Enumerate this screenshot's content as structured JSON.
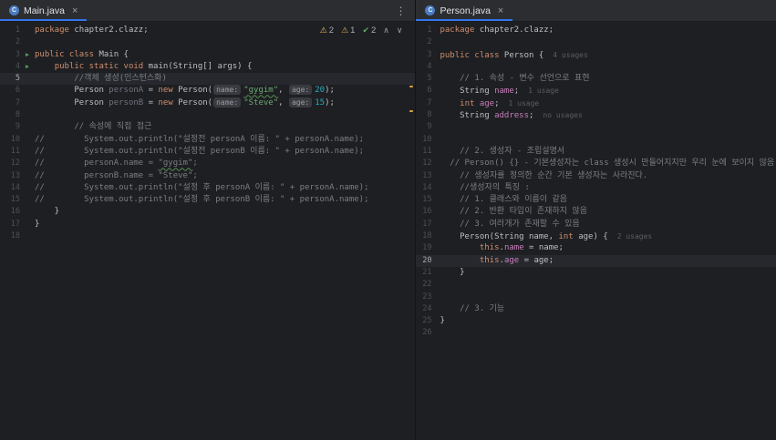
{
  "colors": {
    "editor_bg": "#1e1f22",
    "tab_bg": "#2b2d30",
    "accent": "#3574f0",
    "keyword": "#cf8e6d",
    "string": "#6aab73",
    "number": "#2aacb8",
    "comment": "#7a7e85",
    "field": "#c77dbb",
    "warning": "#f2c55c",
    "ok_green": "#5fad65",
    "run_green": "#57965c",
    "line_highlight": "#26282e"
  },
  "panes": [
    {
      "tab": {
        "label": "Main.java",
        "icon": "C",
        "close": "×"
      },
      "kebab": "⋮",
      "inspection": {
        "warning_icon": "⚠",
        "warning_count": "2",
        "weak_warning_icon": "⚠",
        "weak_warning_count": "1",
        "ok_icon": "✔",
        "ok_count": "2",
        "prev_icon": "∧",
        "next_icon": "∨"
      },
      "lines": [
        {
          "n": "1",
          "s": [
            [
              "kw",
              "package"
            ],
            [
              "def",
              " chapter2.clazz;"
            ]
          ]
        },
        {
          "n": "2",
          "s": []
        },
        {
          "n": "3",
          "g": "run",
          "s": [
            [
              "kw",
              "public class "
            ],
            [
              "def",
              "Main {"
            ]
          ]
        },
        {
          "n": "4",
          "g": "run",
          "s": [
            [
              "def",
              "    "
            ],
            [
              "kw",
              "public static void "
            ],
            [
              "def",
              "main(String[] args) {"
            ]
          ]
        },
        {
          "n": "5",
          "hl": true,
          "s": [
            [
              "cmt",
              "        //객체 생성(인스턴스화)"
            ]
          ]
        },
        {
          "n": "6",
          "s": [
            [
              "def",
              "        Person "
            ],
            [
              "gray",
              "personA"
            ],
            [
              "def",
              " = "
            ],
            [
              "kw",
              "new"
            ],
            [
              "def",
              " Person("
            ],
            [
              "hint",
              "name:"
            ],
            [
              "strU",
              "\"gygim\""
            ],
            [
              "def",
              ", "
            ],
            [
              "hint",
              "age:"
            ],
            [
              "num",
              "20"
            ],
            [
              "def",
              ");"
            ]
          ]
        },
        {
          "n": "7",
          "s": [
            [
              "def",
              "        Person "
            ],
            [
              "gray",
              "personB"
            ],
            [
              "def",
              " = "
            ],
            [
              "kw",
              "new"
            ],
            [
              "def",
              " Person("
            ],
            [
              "hint",
              "name:"
            ],
            [
              "str",
              "\"Steve\""
            ],
            [
              "def",
              ", "
            ],
            [
              "hint",
              "age:"
            ],
            [
              "num",
              "15"
            ],
            [
              "def",
              ");"
            ]
          ]
        },
        {
          "n": "8",
          "s": []
        },
        {
          "n": "9",
          "s": [
            [
              "cmt",
              "        // 속성에 직접 접근"
            ]
          ]
        },
        {
          "n": "10",
          "s": [
            [
              "cmt",
              "//        System.out.println(\"설정전 personA 이름: \" + personA.name);"
            ]
          ]
        },
        {
          "n": "11",
          "s": [
            [
              "cmt",
              "//        System.out.println(\"설정전 personB 이름: \" + personA.name);"
            ]
          ]
        },
        {
          "n": "12",
          "s": [
            [
              "cmt",
              "//        personA.name = "
            ],
            [
              "cmtU",
              "\"gygim\""
            ],
            [
              "cmt",
              ";"
            ]
          ]
        },
        {
          "n": "13",
          "s": [
            [
              "cmt",
              "//        personB.name = \"Steve\";"
            ]
          ]
        },
        {
          "n": "14",
          "s": [
            [
              "cmt",
              "//        System.out.println(\"설정 후 personA 이름: \" + personA.name);"
            ]
          ]
        },
        {
          "n": "15",
          "s": [
            [
              "cmt",
              "//        System.out.println(\"설정 후 personB 이름: \" + personA.name);"
            ]
          ]
        },
        {
          "n": "16",
          "s": [
            [
              "def",
              "    }"
            ]
          ]
        },
        {
          "n": "17",
          "s": [
            [
              "def",
              "}"
            ]
          ]
        },
        {
          "n": "18",
          "s": []
        }
      ]
    },
    {
      "tab": {
        "label": "Person.java",
        "icon": "C",
        "close": "×"
      },
      "lines": [
        {
          "n": "1",
          "s": [
            [
              "kw",
              "package"
            ],
            [
              "def",
              " chapter2.clazz;"
            ]
          ]
        },
        {
          "n": "2",
          "s": []
        },
        {
          "n": "3",
          "s": [
            [
              "kw",
              "public class "
            ],
            [
              "def",
              "Person {"
            ],
            [
              "usage",
              "4 usages"
            ]
          ]
        },
        {
          "n": "4",
          "s": []
        },
        {
          "n": "5",
          "s": [
            [
              "cmt",
              "    // 1. 속성 - 변수 선언으로 표현"
            ]
          ]
        },
        {
          "n": "6",
          "s": [
            [
              "def",
              "    String "
            ],
            [
              "field",
              "name"
            ],
            [
              "def",
              ";"
            ],
            [
              "usage",
              "1 usage"
            ]
          ]
        },
        {
          "n": "7",
          "s": [
            [
              "def",
              "    "
            ],
            [
              "kw",
              "int"
            ],
            [
              "def",
              " "
            ],
            [
              "field",
              "age"
            ],
            [
              "def",
              ";"
            ],
            [
              "usage",
              "1 usage"
            ]
          ]
        },
        {
          "n": "8",
          "s": [
            [
              "def",
              "    String "
            ],
            [
              "field",
              "address"
            ],
            [
              "def",
              ";"
            ],
            [
              "usage",
              "no usages"
            ]
          ]
        },
        {
          "n": "9",
          "s": []
        },
        {
          "n": "10",
          "s": []
        },
        {
          "n": "11",
          "s": [
            [
              "cmt",
              "    // 2. 생성자 - 조립설명서"
            ]
          ]
        },
        {
          "n": "12",
          "s": [
            [
              "cmt",
              "  // Person() {} - 기본생성자는 class 생성시 만들어지지만 우리 눈에 보이지 않음"
            ]
          ]
        },
        {
          "n": "13",
          "s": [
            [
              "cmt",
              "    // 생성자를 정의한 순간 기본 생성자는 사라진다."
            ]
          ]
        },
        {
          "n": "14",
          "s": [
            [
              "cmt",
              "    //생성자의 특징 :"
            ]
          ]
        },
        {
          "n": "15",
          "s": [
            [
              "cmt",
              "    // 1. 클래스와 이름이 같음"
            ]
          ]
        },
        {
          "n": "16",
          "s": [
            [
              "cmt",
              "    // 2. 반환 타입이 존재하지 않음"
            ]
          ]
        },
        {
          "n": "17",
          "s": [
            [
              "cmt",
              "    // 3. 여러개가 존재할 수 있음"
            ]
          ]
        },
        {
          "n": "18",
          "s": [
            [
              "def",
              "    Person(String name, "
            ],
            [
              "kw",
              "int"
            ],
            [
              "def",
              " age) {"
            ],
            [
              "usage",
              "2 usages"
            ]
          ]
        },
        {
          "n": "19",
          "s": [
            [
              "def",
              "        "
            ],
            [
              "kw",
              "this"
            ],
            [
              "def",
              "."
            ],
            [
              "field",
              "name"
            ],
            [
              "def",
              " = name;"
            ]
          ]
        },
        {
          "n": "20",
          "hl": true,
          "s": [
            [
              "def",
              "        "
            ],
            [
              "kw",
              "this"
            ],
            [
              "def",
              "."
            ],
            [
              "field",
              "age"
            ],
            [
              "def",
              " = age;"
            ]
          ]
        },
        {
          "n": "21",
          "s": [
            [
              "def",
              "    }"
            ]
          ]
        },
        {
          "n": "22",
          "s": []
        },
        {
          "n": "23",
          "s": []
        },
        {
          "n": "24",
          "s": [
            [
              "cmt",
              "    // 3. 기능"
            ]
          ]
        },
        {
          "n": "25",
          "s": [
            [
              "def",
              "}"
            ]
          ]
        },
        {
          "n": "26",
          "s": []
        }
      ]
    }
  ]
}
